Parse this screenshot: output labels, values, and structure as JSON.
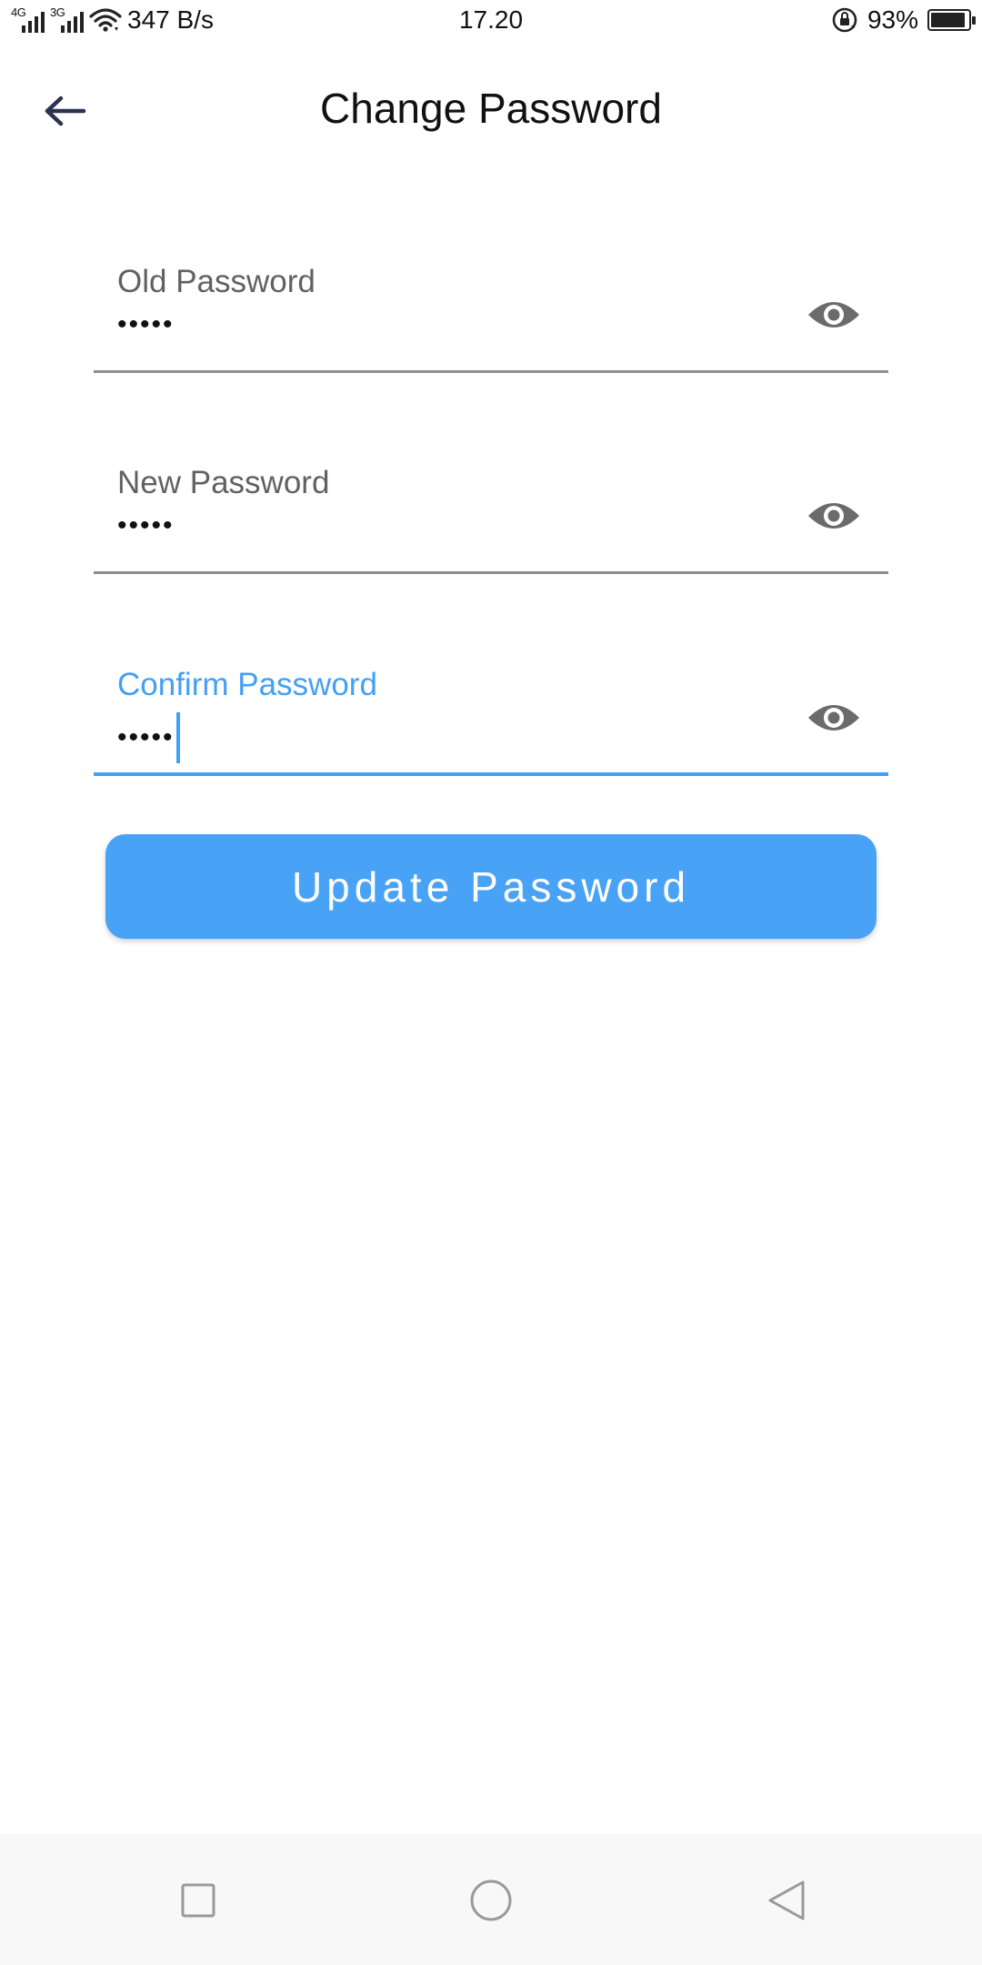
{
  "status_bar": {
    "network_1": "4G",
    "network_2": "3G",
    "speed": "347 B/s",
    "time": "17.20",
    "battery": "93%",
    "battery_level": 0.93
  },
  "header": {
    "title": "Change Password",
    "back_icon": "arrow-back-icon"
  },
  "form": {
    "old_password": {
      "label": "Old Password",
      "value": "•••••"
    },
    "new_password": {
      "label": "New Password",
      "value": "•••••"
    },
    "confirm_password": {
      "label": "Confirm Password",
      "value": "•••••",
      "focused": true
    },
    "visibility_icon": "eye-icon",
    "submit_label": "Update Password"
  },
  "nav_bar": {
    "recent_icon": "square-icon",
    "home_icon": "circle-icon",
    "back_icon": "triangle-back-icon"
  },
  "colors": {
    "accent": "#48a2f6",
    "label_gray": "#616161",
    "underline_gray": "#8e8e8e",
    "icon_gray": "#6b6b6b",
    "nav_bg": "#f8f8f8"
  }
}
